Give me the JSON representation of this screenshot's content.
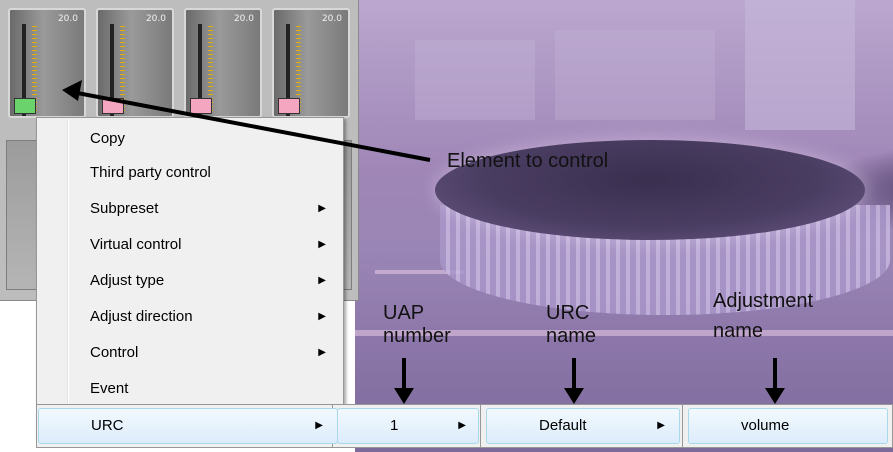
{
  "faders": {
    "items": [
      {
        "value": "20.0",
        "cap_color": "#6bd36b"
      },
      {
        "value": "20.0",
        "cap_color": "#f4a6c0"
      },
      {
        "value": "20.0",
        "cap_color": "#f4a6c0"
      },
      {
        "value": "20.0",
        "cap_color": "#f4a6c0"
      }
    ]
  },
  "context_menu": {
    "items": [
      {
        "label": "Copy",
        "has_submenu": false
      },
      {
        "label": "Third party control",
        "has_submenu": false
      },
      {
        "label": "Subpreset",
        "has_submenu": true
      },
      {
        "label": "Virtual control",
        "has_submenu": true
      },
      {
        "label": "Adjust type",
        "has_submenu": true
      },
      {
        "label": "Adjust direction",
        "has_submenu": true
      },
      {
        "label": "Control",
        "has_submenu": true
      },
      {
        "label": "Event",
        "has_submenu": false
      }
    ],
    "selected": {
      "label": "URC",
      "has_submenu": true
    },
    "arrow_glyph": "▶"
  },
  "cascade": {
    "uap": {
      "label": "1",
      "has_submenu": true
    },
    "urc": {
      "label": "Default",
      "has_submenu": true
    },
    "adjustment": {
      "label": "volume",
      "has_submenu": false
    }
  },
  "annotations": {
    "element_to_control": "Element to control",
    "uap_line1": "UAP",
    "uap_line2": "number",
    "urc_line1": "URC",
    "urc_line2": "name",
    "adj_line1": "Adjustment",
    "adj_line2": "name"
  },
  "colors": {
    "menu_bg": "#f0f0f0",
    "highlight_border": "#a8d8eb",
    "highlight_fill": "#dcecfc"
  }
}
